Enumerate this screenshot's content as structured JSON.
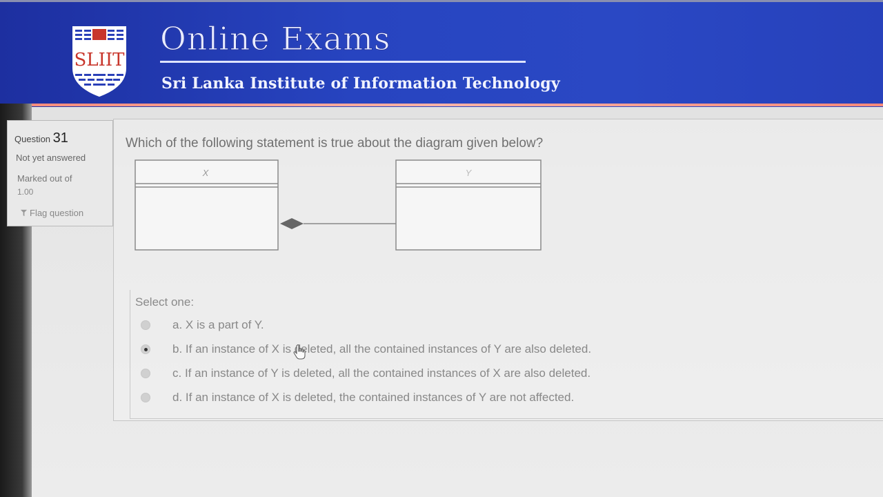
{
  "header": {
    "site_title": "Online Exams",
    "subtitle": "Sri Lanka Institute of Information Technology",
    "logo_text": "SLIIT"
  },
  "question_info": {
    "label": "Question",
    "number": "31",
    "state": "Not yet answered",
    "marked_out_of_label": "Marked out of",
    "marked_out_of_value": "1.00",
    "flag_label": "Flag question",
    "flag_icon": "flag-icon"
  },
  "question": {
    "text": "Which of the following statement is true about the diagram given below?",
    "diagram": {
      "class_left": "X",
      "class_right": "Y",
      "relationship": "composition"
    },
    "select_label": "Select one:",
    "options": [
      {
        "label": "a. X is a part of Y.",
        "selected": false
      },
      {
        "label": "b. If an instance of X is deleted, all the contained instances of Y are also deleted.",
        "selected": true
      },
      {
        "label": "c. If an instance of Y is deleted, all the contained instances of X are also deleted.",
        "selected": false
      },
      {
        "label": "d. If an instance of X is deleted, the contained instances of Y are not affected.",
        "selected": false
      }
    ]
  },
  "colors": {
    "header_blue": "#2744c0",
    "header_rule": "#ff8a7a",
    "logo_red": "#c8362c"
  }
}
